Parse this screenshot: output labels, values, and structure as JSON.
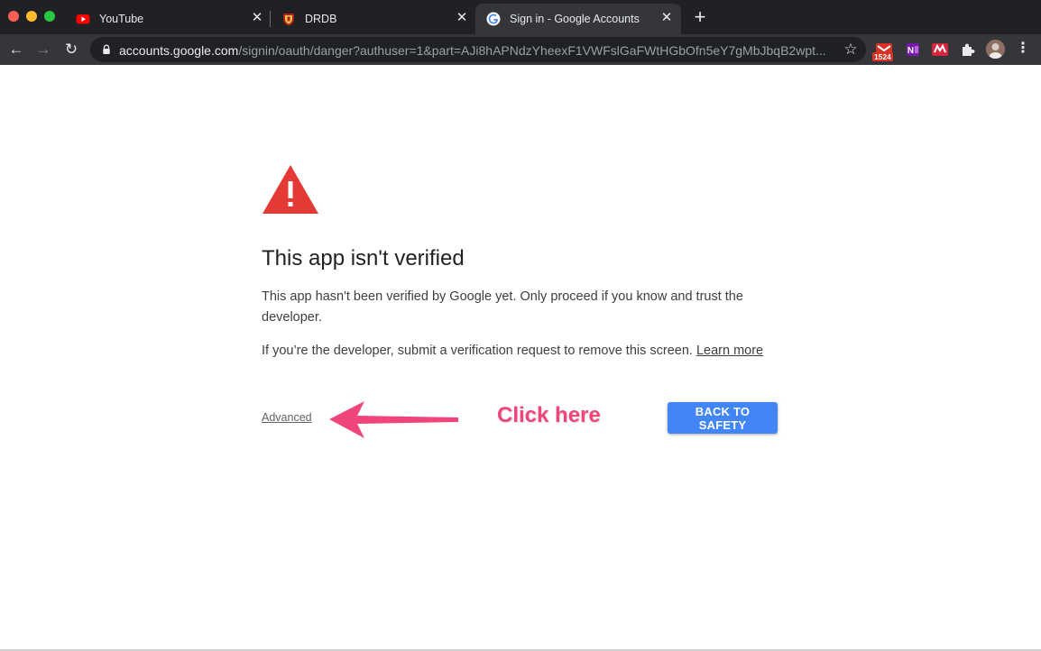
{
  "browser": {
    "tabs": [
      {
        "title": "YouTube",
        "icon": "youtube-icon"
      },
      {
        "title": "DRDB",
        "icon": "drdb-shield-icon"
      },
      {
        "title": "Sign in - Google Accounts",
        "icon": "google-g-icon",
        "active": true
      }
    ],
    "close_glyph": "✕",
    "new_tab_glyph": "+",
    "url": {
      "host": "accounts.google.com",
      "path": "/signin/oauth/danger?authuser=1&part=AJi8hAPNdzYheexF1VWFslGaFWtHGbOfn5eY7gMbJbqB2wpt..."
    },
    "extension_badge": "1524"
  },
  "page": {
    "heading": "This app isn't verified",
    "paragraph1": "This app hasn't been verified by Google yet. Only proceed if you know and trust the developer.",
    "paragraph2": "If you’re the developer, submit a verification request to remove this screen.",
    "learn_more": "Learn more",
    "advanced_link": "Advanced",
    "back_button": "BACK TO SAFETY",
    "annotation": "Click here"
  },
  "colors": {
    "warning_red": "#e53935",
    "button_blue": "#4285f4",
    "annotation_pink": "#f0457a"
  }
}
